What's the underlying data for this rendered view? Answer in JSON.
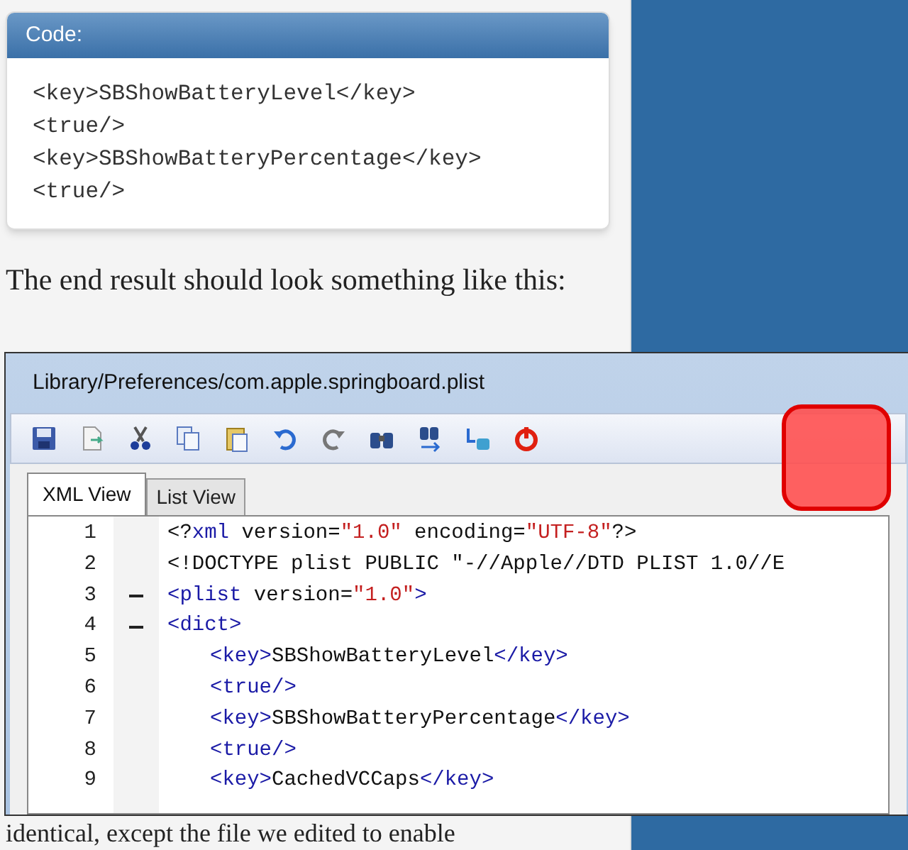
{
  "code_box": {
    "title": "Code:",
    "lines": [
      "<key>SBShowBatteryLevel</key>",
      "<true/>",
      "<key>SBShowBatteryPercentage</key>",
      "<true/>"
    ]
  },
  "paragraph": "The end result should look something like this:",
  "window": {
    "title": "Library/Preferences/com.apple.springboard.plist",
    "toolbar": [
      {
        "kind": "save"
      },
      {
        "kind": "export"
      },
      {
        "kind": "cut"
      },
      {
        "kind": "copy"
      },
      {
        "kind": "paste"
      },
      {
        "kind": "undo"
      },
      {
        "kind": "redo"
      },
      {
        "kind": "find"
      },
      {
        "kind": "find-next"
      },
      {
        "kind": "replace"
      },
      {
        "kind": "power"
      }
    ],
    "tabs": [
      {
        "label": "XML View",
        "selected": true
      },
      {
        "label": "List View",
        "selected": false
      }
    ],
    "lines": [
      {
        "number": "1",
        "fold": false,
        "tokens": [
          {
            "kind": "plain",
            "text": "<?"
          },
          {
            "kind": "tag",
            "text": "xml"
          },
          {
            "kind": "plain",
            "text": " version="
          },
          {
            "kind": "string",
            "text": "\"1.0\""
          },
          {
            "kind": "plain",
            "text": " encoding="
          },
          {
            "kind": "string",
            "text": "\"UTF-8\""
          },
          {
            "kind": "plain",
            "text": "?>"
          }
        ]
      },
      {
        "number": "2",
        "fold": false,
        "tokens": [
          {
            "kind": "plain",
            "text": "<!DOCTYPE plist PUBLIC \"-//Apple//DTD PLIST 1.0//E"
          }
        ]
      },
      {
        "number": "3",
        "fold": true,
        "tokens": [
          {
            "kind": "tag",
            "text": "<plist"
          },
          {
            "kind": "plain",
            "text": " version="
          },
          {
            "kind": "string",
            "text": "\"1.0\""
          },
          {
            "kind": "tag",
            "text": ">"
          }
        ]
      },
      {
        "number": "4",
        "fold": true,
        "tokens": [
          {
            "kind": "tag",
            "text": "<dict>"
          }
        ],
        "children": [
          {
            "number": "5",
            "fold": false,
            "tokens": [
              {
                "kind": "tag",
                "text": "<key>"
              },
              {
                "kind": "plain",
                "text": "SBShowBatteryLevel"
              },
              {
                "kind": "tag",
                "text": "</key>"
              }
            ]
          },
          {
            "number": "6",
            "fold": false,
            "tokens": [
              {
                "kind": "tag",
                "text": "<true/>"
              }
            ]
          },
          {
            "number": "7",
            "fold": false,
            "tokens": [
              {
                "kind": "tag",
                "text": "<key>"
              },
              {
                "kind": "plain",
                "text": "SBShowBatteryPercentage"
              },
              {
                "kind": "tag",
                "text": "</key>"
              }
            ]
          },
          {
            "number": "8",
            "fold": false,
            "tokens": [
              {
                "kind": "tag",
                "text": "<true/>"
              }
            ]
          },
          {
            "number": "9",
            "fold": false,
            "tokens": [
              {
                "kind": "tag",
                "text": "<key>"
              },
              {
                "kind": "plain",
                "text": "CachedVCCaps"
              },
              {
                "kind": "tag",
                "text": "</key>"
              }
            ]
          }
        ]
      }
    ]
  },
  "trailing_text": "identical, except the file we edited to enable"
}
